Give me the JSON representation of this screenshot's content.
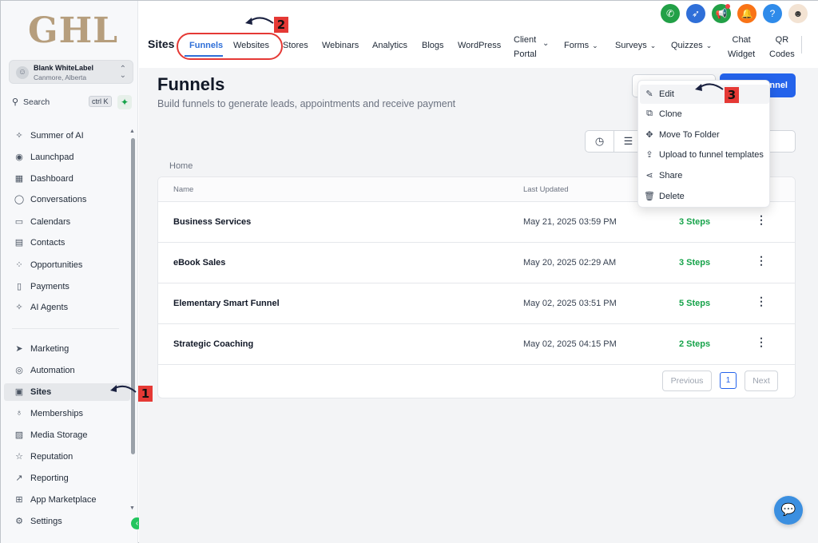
{
  "sidebar": {
    "logo": "GHL",
    "account": {
      "name": "Blank WhiteLabel",
      "location": "Canmore, Alberta"
    },
    "search": {
      "label": "Search",
      "shortcut": "ctrl K"
    },
    "items": [
      {
        "label": "Summer of AI",
        "icon": "sparkle-icon"
      },
      {
        "label": "Launchpad",
        "icon": "rocket-icon"
      },
      {
        "label": "Dashboard",
        "icon": "grid-icon"
      },
      {
        "label": "Conversations",
        "icon": "chat-icon"
      },
      {
        "label": "Calendars",
        "icon": "calendar-icon"
      },
      {
        "label": "Contacts",
        "icon": "contacts-icon"
      },
      {
        "label": "Opportunities",
        "icon": "opportunities-icon"
      },
      {
        "label": "Payments",
        "icon": "payments-icon"
      },
      {
        "label": "AI Agents",
        "icon": "sparkle-icon"
      },
      {
        "label": "Marketing",
        "icon": "send-icon"
      },
      {
        "label": "Automation",
        "icon": "automation-icon"
      },
      {
        "label": "Sites",
        "icon": "sites-icon",
        "active": true
      },
      {
        "label": "Memberships",
        "icon": "badge-icon"
      },
      {
        "label": "Media Storage",
        "icon": "image-icon"
      },
      {
        "label": "Reputation",
        "icon": "star-icon"
      },
      {
        "label": "Reporting",
        "icon": "trend-icon"
      },
      {
        "label": "App Marketplace",
        "icon": "apps-icon"
      },
      {
        "label": "Settings",
        "icon": "gear-icon"
      }
    ]
  },
  "header": {
    "section": "Sites",
    "tabs": [
      {
        "label": "Funnels",
        "active": true
      },
      {
        "label": "Websites"
      },
      {
        "label": "Stores"
      },
      {
        "label": "Webinars"
      },
      {
        "label": "Analytics"
      },
      {
        "label": "Blogs"
      },
      {
        "label": "WordPress"
      },
      {
        "label": "Client Portal",
        "line1": "Client",
        "line2": "Portal",
        "dropdown": true
      },
      {
        "label": "Forms",
        "dropdown": true
      },
      {
        "label": "Surveys",
        "dropdown": true
      },
      {
        "label": "Quizzes",
        "dropdown": true
      },
      {
        "label": "Chat Widget",
        "line1": "Chat",
        "line2": "Widget"
      },
      {
        "label": "QR Codes",
        "line1": "QR",
        "line2": "Codes"
      }
    ],
    "icons": {
      "phone": {
        "icon": "phone-icon",
        "color": "#22a047"
      },
      "launch": {
        "icon": "rocket-icon",
        "color": "#2f6fd8"
      },
      "announce": {
        "icon": "megaphone-icon",
        "color": "#22a047"
      },
      "notify": {
        "icon": "bell-icon",
        "color": "#f97316"
      },
      "help": {
        "icon": "help-icon",
        "color": "#2f8bea",
        "label": "?"
      }
    }
  },
  "main": {
    "title": "Funnels",
    "subtitle": "Build funnels to generate leads, appointments and receive payment",
    "new_button": "nnel",
    "breadcrumb": "Home",
    "columns": {
      "name": "Name",
      "updated": "Last Updated"
    },
    "rows": [
      {
        "name": "Business Services",
        "updated": "May 21, 2025 03:59 PM",
        "steps": "3 Steps"
      },
      {
        "name": "eBook Sales",
        "updated": "May 20, 2025 02:29 AM",
        "steps": "3 Steps"
      },
      {
        "name": "Elementary Smart Funnel",
        "updated": "May 02, 2025 03:51 PM",
        "steps": "5 Steps"
      },
      {
        "name": "Strategic Coaching",
        "updated": "May 02, 2025 04:15 PM",
        "steps": "2 Steps"
      }
    ],
    "pagination": {
      "previous": "Previous",
      "page": "1",
      "next": "Next"
    }
  },
  "context_menu": {
    "items": [
      {
        "label": "Edit",
        "icon": "pencil-icon"
      },
      {
        "label": "Clone",
        "icon": "copy-icon"
      },
      {
        "label": "Move To Folder",
        "icon": "move-icon"
      },
      {
        "label": "Upload to funnel templates",
        "icon": "upload-icon"
      },
      {
        "label": "Share",
        "icon": "share-icon"
      },
      {
        "label": "Delete",
        "icon": "trash-icon"
      }
    ]
  },
  "annotations": {
    "step1": "1",
    "step2": "2",
    "step3": "3"
  },
  "colors": {
    "accent": "#2463eb",
    "success": "#16a34a",
    "annotation": "#e53935",
    "logo": "#b69e7d"
  }
}
